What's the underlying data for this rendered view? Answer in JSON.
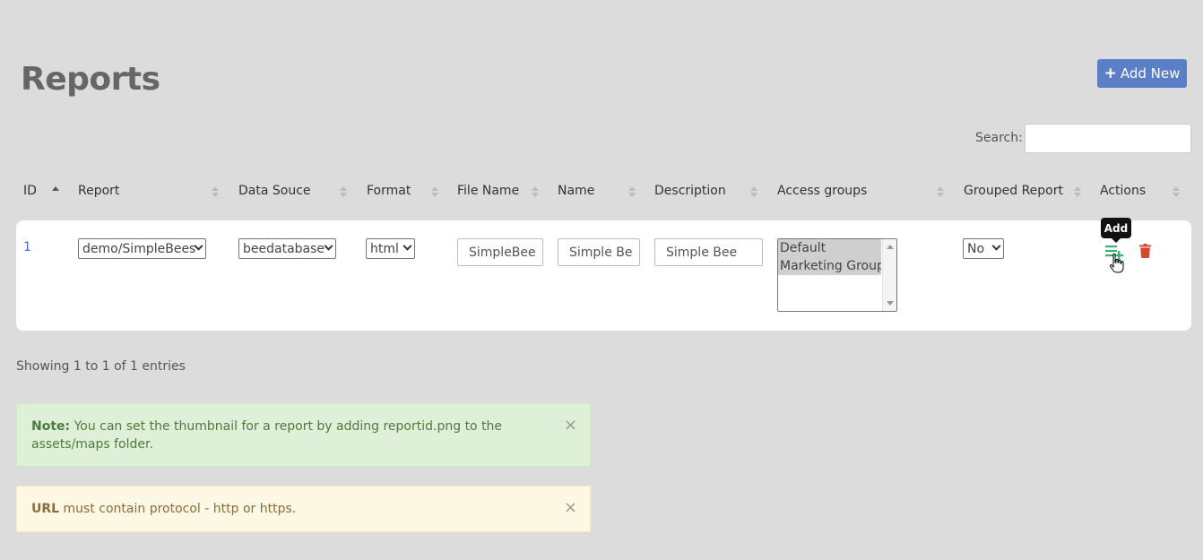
{
  "page": {
    "title": "Reports"
  },
  "toolbar": {
    "add_new_label": "Add New",
    "plus_glyph": "+"
  },
  "search": {
    "label": "Search:",
    "value": "",
    "placeholder": ""
  },
  "table": {
    "columns": [
      "ID",
      "Report",
      "Data Souce",
      "Format",
      "File Name",
      "Name",
      "Description",
      "Access groups",
      "Grouped Report",
      "Actions"
    ],
    "rows": [
      {
        "id": "1",
        "report": "demo/SimpleBees",
        "data_source": "beedatabase",
        "format": "html",
        "file_name": "SimpleBee",
        "name": "Simple Be",
        "description": "Simple Bee",
        "access_groups": [
          "Default",
          "Marketing Group"
        ],
        "grouped_report": "No"
      }
    ]
  },
  "actions": {
    "tooltip": "Add",
    "add_icon": "list-add-icon",
    "delete_icon": "trash-icon"
  },
  "footer": {
    "entries_info": "Showing 1 to 1 of 1 entries"
  },
  "alerts": {
    "note": {
      "label": "Note:",
      "text": "You can set the thumbnail for a report by adding reportid.png to the assets/maps folder.",
      "close": "×"
    },
    "url": {
      "label": "URL",
      "text": "must contain protocol - http or https.",
      "close": "×"
    }
  },
  "colors": {
    "primary": "#5b7fc6",
    "add_action": "#3cb371",
    "delete_action": "#d9472b",
    "success_bg": "#dff0d8",
    "warning_bg": "#fcf8e3",
    "link": "#3a6fd8"
  }
}
